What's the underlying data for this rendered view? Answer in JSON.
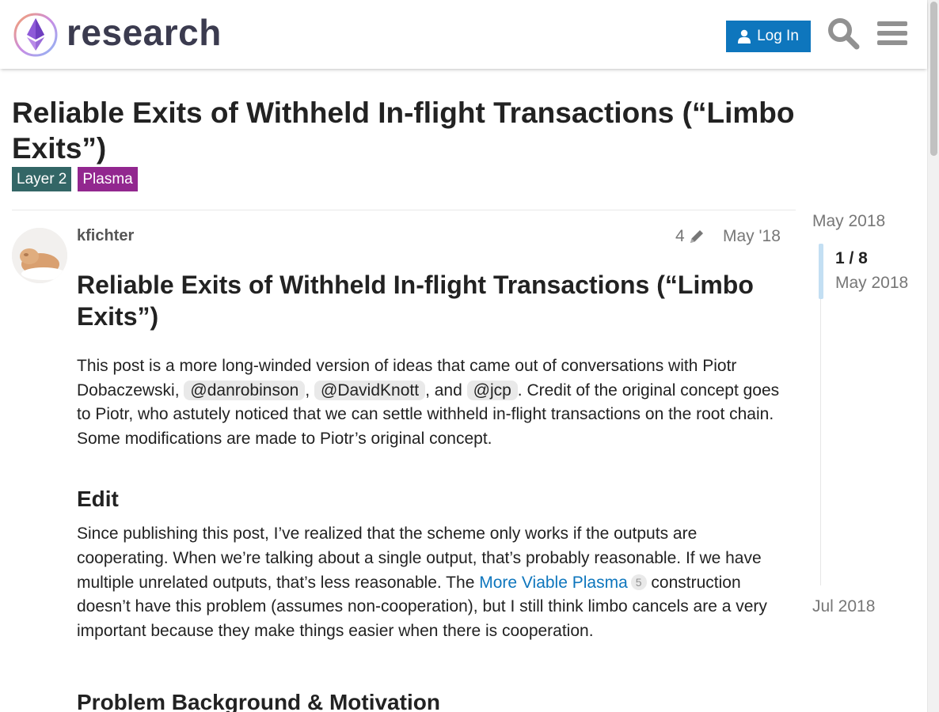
{
  "header": {
    "site_name": "research",
    "login_label": "Log In",
    "icons": [
      "ethereum-logo-icon",
      "user-icon",
      "search-icon",
      "hamburger-menu-icon"
    ]
  },
  "topic": {
    "title": "Reliable Exits of Withheld In-flight Transactions (“Limbo Exits”)",
    "tags": [
      {
        "label": "Layer 2",
        "color": "#336666"
      },
      {
        "label": "Plasma",
        "color": "#92278f"
      }
    ]
  },
  "post": {
    "username": "kfichter",
    "edit_count": "4",
    "date": "May '18",
    "heading": "Reliable Exits of Withheld In-flight Transactions (“Limbo Exits”)",
    "intro": {
      "text1": "This post is a more long-winded version of ideas that came out of conversations with Piotr Dobaczewski,",
      "mention1": "@danrobinson",
      "sep1": ",",
      "mention2": "@DavidKnott",
      "sep2": ", and",
      "mention3": "@jcp",
      "text2": ". Credit of the original concept goes to Piotr, who astutely noticed that we can settle withheld in-flight transactions on the root chain. Some modifications are made to Piotr’s original concept."
    },
    "edit_heading": "Edit",
    "edit_para": {
      "text1": "Since publishing this post, I’ve realized that the scheme only works if the outputs are cooperating. When we’re talking about a single output, that’s probably reasonable. If we have multiple unrelated outputs, that’s less reasonable. The",
      "link": "More Viable Plasma",
      "link_clicks": "5",
      "text2": "construction doesn’t have this problem (assumes non-cooperation), but I still think limbo cancels are a very important because they make things easier when there is cooperation."
    },
    "problem_heading": "Problem Background & Motivation"
  },
  "timeline": {
    "start_label": "May 2018",
    "position": "1 / 8",
    "position_date": "May 2018",
    "end_label": "Jul 2018"
  },
  "colors": {
    "accent": "#0e76bd",
    "tag_layer2": "#336666",
    "tag_plasma": "#92278f",
    "muted_text": "#777777"
  }
}
